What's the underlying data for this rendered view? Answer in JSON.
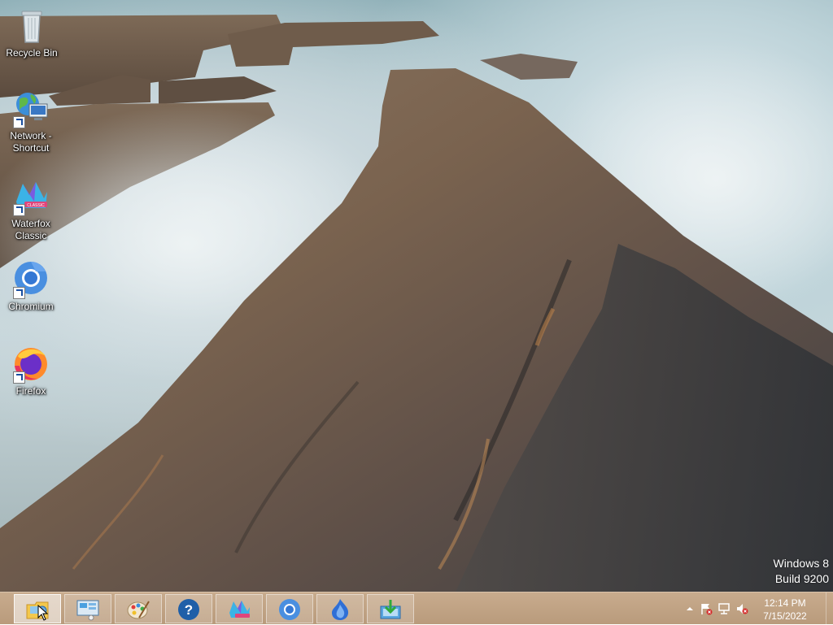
{
  "desktop": {
    "icons": [
      {
        "label": "Recycle Bin",
        "icon": "recycle-bin-icon"
      },
      {
        "label": "Network - Shortcut",
        "icon": "network-icon"
      },
      {
        "label": "Waterfox Classic",
        "icon": "waterfox-icon"
      },
      {
        "label": "Chromium",
        "icon": "chromium-icon"
      },
      {
        "label": "Firefox",
        "icon": "firefox-icon"
      }
    ],
    "watermark": {
      "line1": "Windows 8",
      "line2": "Build 9200"
    }
  },
  "taskbar": {
    "pinned": [
      {
        "icon": "file-explorer-icon",
        "active": true
      },
      {
        "icon": "control-panel-icon",
        "active": false
      },
      {
        "icon": "paint-icon",
        "active": false
      },
      {
        "icon": "help-icon",
        "active": false
      },
      {
        "icon": "waterfox-icon",
        "active": false
      },
      {
        "icon": "chromium-icon",
        "active": false
      },
      {
        "icon": "flame-app-icon",
        "active": false
      },
      {
        "icon": "installer-icon",
        "active": false
      }
    ],
    "tray": {
      "icons": [
        "show-hidden-icons-chevron",
        "action-center-flag-icon",
        "network-tray-icon",
        "volume-muted-icon"
      ],
      "time": "12:14 PM",
      "date": "7/15/2022"
    }
  },
  "colors": {
    "taskbar": "#bfa283",
    "taskbar_highlight": "#d9c3ab",
    "icon_text": "#ffffff"
  }
}
